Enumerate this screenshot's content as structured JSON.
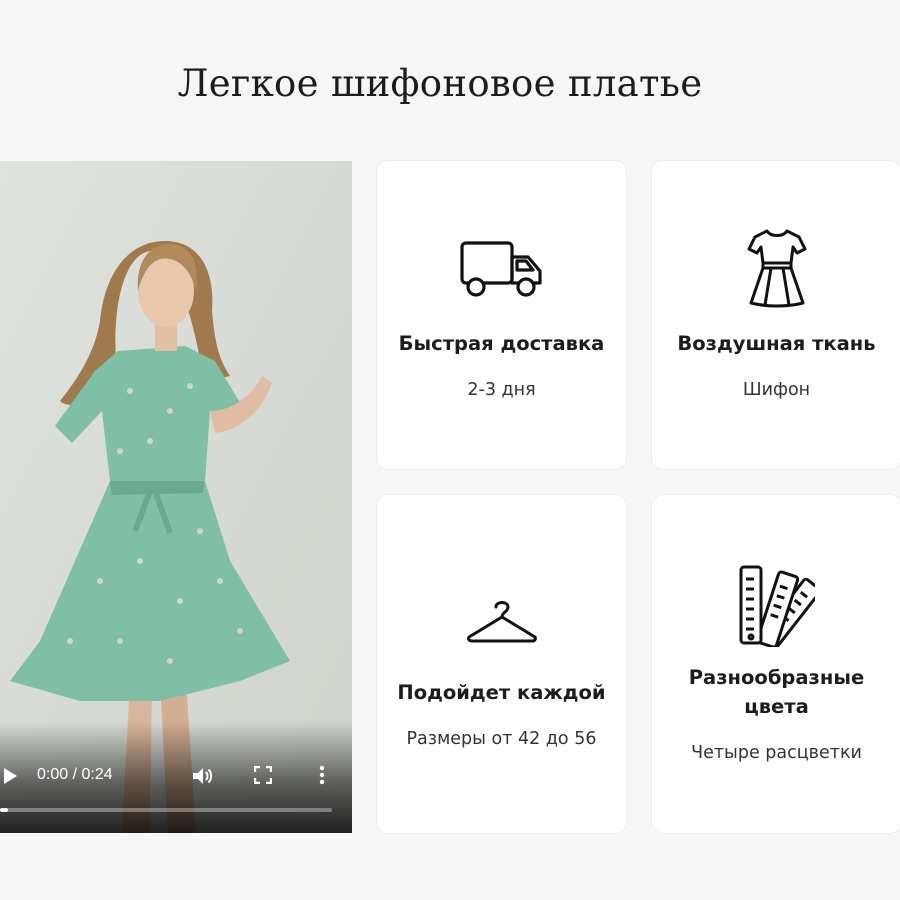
{
  "page": {
    "title": "Легкое шифоновое платье"
  },
  "video": {
    "current_time": "0:00",
    "duration": "0:24",
    "time_display": "0:00 / 0:24",
    "progress": 0.0
  },
  "features": [
    {
      "title": "Быстрая доставка",
      "subtitle": "2-3 дня",
      "icon": "truck-icon"
    },
    {
      "title": "Воздушная ткань",
      "subtitle": "Шифон",
      "icon": "dress-icon"
    },
    {
      "title": "Подойдет каждой",
      "subtitle": "Размеры от 42 до 56",
      "icon": "hanger-icon"
    },
    {
      "title_line1": "Разнообразные",
      "title_line2": "цвета",
      "subtitle": "Четыре расцветки",
      "icon": "color-swatches-icon"
    }
  ],
  "colors": {
    "background": "#f6f6f6",
    "card": "#ffffff",
    "card_border": "#f6e7ea",
    "dress": "#7fbfa5"
  }
}
